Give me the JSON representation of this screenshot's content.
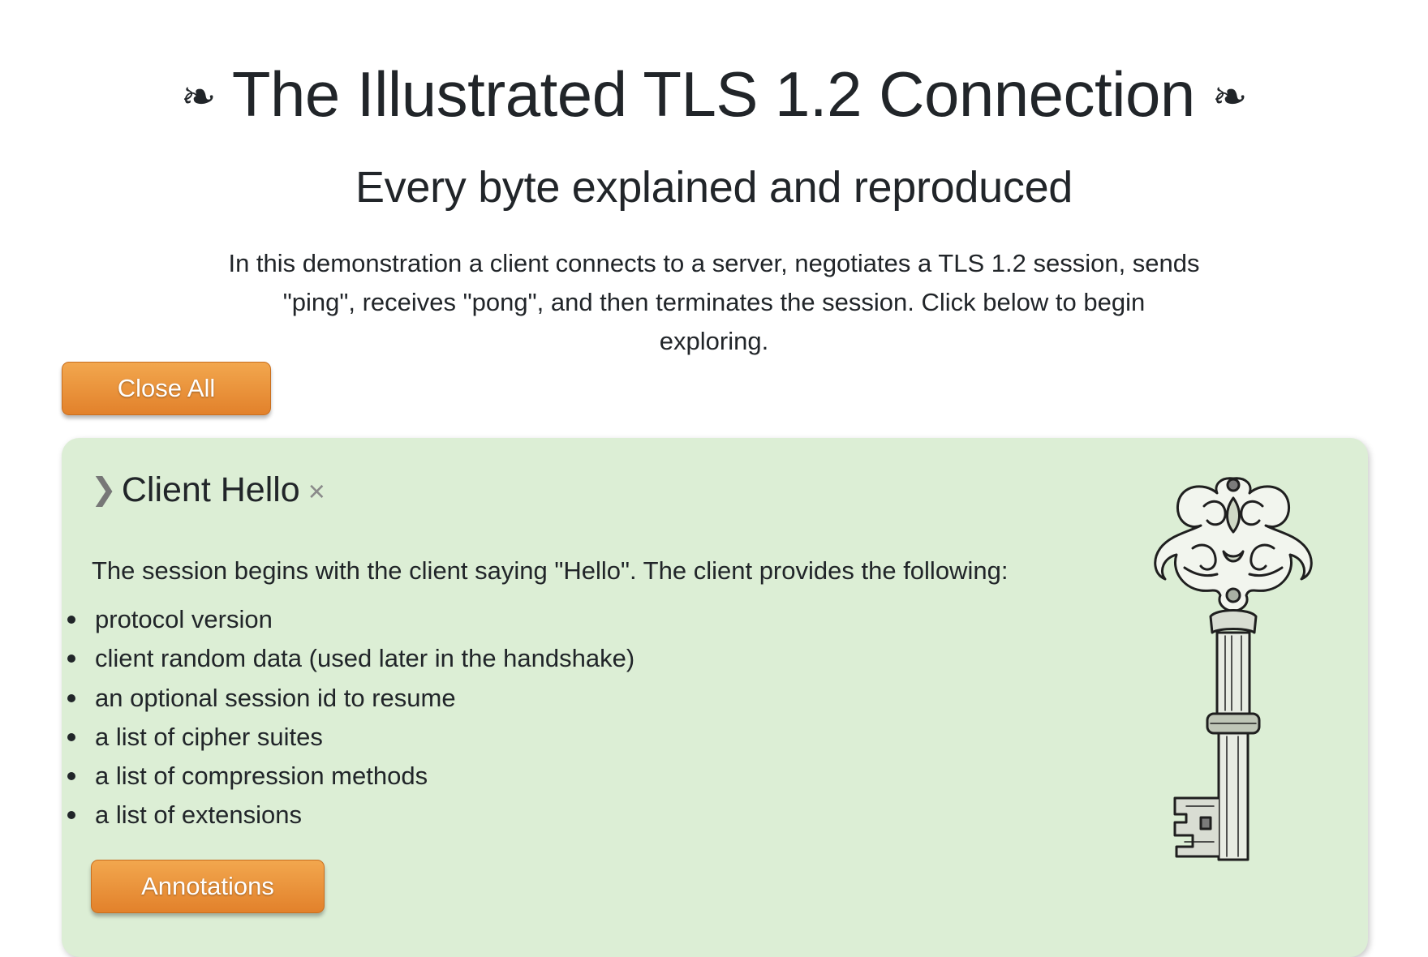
{
  "header": {
    "fleuron": "❧",
    "title": "The Illustrated TLS 1.2 Connection",
    "subtitle": "Every byte explained and reproduced"
  },
  "intro": {
    "text": "In this demonstration a client connects to a server, negotiates a TLS 1.2 session, sends \"ping\", receives \"pong\", and then terminates the session. Click below to begin exploring."
  },
  "toolbar": {
    "close_all_label": "Close All"
  },
  "section": {
    "chevron": "❯",
    "title": "Client Hello",
    "close_symbol": "×",
    "description": "The session begins with the client saying \"Hello\". The client provides the following:",
    "items": [
      "protocol version",
      "client random data (used later in the handshake)",
      "an optional session id to resume",
      "a list of cipher suites",
      "a list of compression methods",
      "a list of extensions"
    ],
    "annotations_label": "Annotations",
    "background_color": "#dceed5",
    "button_color": "#e8902f",
    "illustration_icon": "skeleton-key-icon"
  }
}
